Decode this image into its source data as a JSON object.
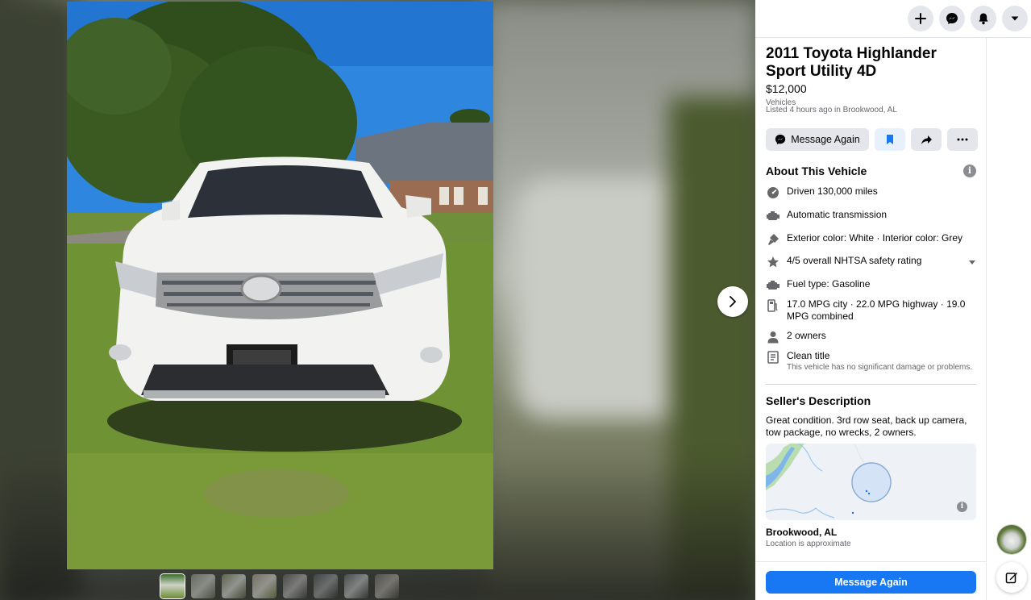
{
  "listing": {
    "title": "2011 Toyota Highlander Sport Utility 4D",
    "price": "$12,000",
    "category": "Vehicles",
    "listed": "Listed 4 hours ago in Brookwood, AL"
  },
  "actions": {
    "message_again": "Message Again",
    "save_icon": "bookmark-icon",
    "share_icon": "share-arrow-icon",
    "more_icon": "more-dots-icon"
  },
  "about": {
    "heading": "About This Vehicle",
    "features": [
      {
        "icon": "odometer-icon",
        "text": "Driven 130,000 miles"
      },
      {
        "icon": "transmission-icon",
        "text": "Automatic transmission"
      },
      {
        "icon": "paint-icon",
        "text": "Exterior color: White · Interior color: Grey"
      },
      {
        "icon": "star-icon",
        "text": "4/5 overall NHTSA safety rating"
      },
      {
        "icon": "engine-icon",
        "text": "Fuel type: Gasoline"
      },
      {
        "icon": "fuel-pump-icon",
        "text": "17.0 MPG city · 22.0 MPG highway · 19.0 MPG combined"
      },
      {
        "icon": "person-icon",
        "text": "2 owners"
      },
      {
        "icon": "title-document-icon",
        "text": "Clean title",
        "sub": "This vehicle has no significant damage or problems."
      }
    ]
  },
  "seller": {
    "heading": "Seller's Description",
    "description": "Great condition. 3rd row seat, back up camera, tow package, no wrecks, 2 owners."
  },
  "location": {
    "name": "Brookwood, AL",
    "note": "Location is approximate"
  },
  "footer": {
    "message_button": "Message Again"
  },
  "topbar": {
    "icons": [
      "plus-icon",
      "messenger-icon",
      "bell-icon",
      "caret-down-icon"
    ]
  },
  "photo": {
    "thumbnail_count": 8,
    "active_index": 0
  },
  "colors": {
    "accent": "#1877f2",
    "button_gray": "#e4e6eb",
    "secondary_text": "#65676b"
  }
}
